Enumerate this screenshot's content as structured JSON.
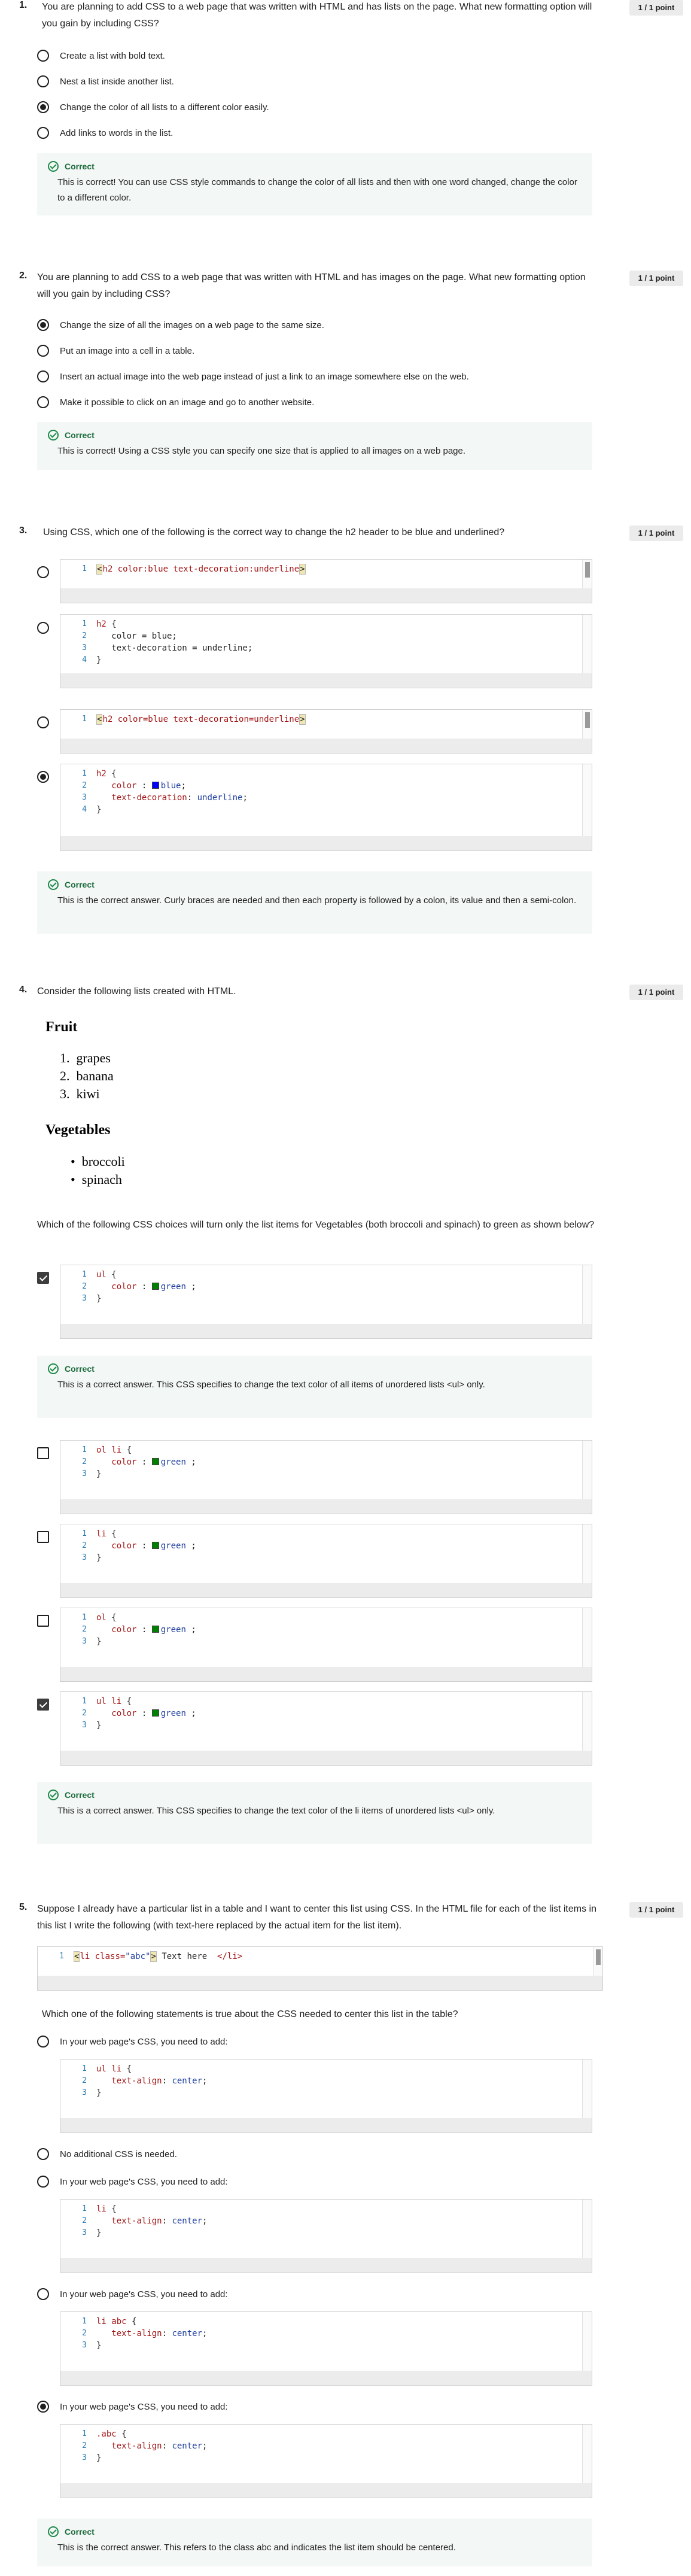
{
  "points_label": "1 / 1 point",
  "correct_label": "Correct",
  "q1": {
    "num": "1.",
    "text": "You are planning to add CSS to a web page that was written with HTML and has lists on the page. What new formatting option will you gain by including CSS?",
    "options": [
      "Create a list with bold text.",
      "Nest a list inside another list.",
      "Change the color of all lists to a different color easily.",
      "Add links to words in the list."
    ],
    "feedback": "This is correct! You can use CSS style commands to change the color of all lists and then with one word changed, change the color to a different color."
  },
  "q2": {
    "num": "2.",
    "text": "You are planning to add CSS to a web page that was written with HTML and has images on the page. What new formatting option will you gain by including CSS?",
    "options": [
      "Change the size of all the images on a web page to the same size.",
      "Put an image into a cell in a table.",
      "Insert an actual image into the web page instead of just a link to an image somewhere else on the web.",
      "Make it possible to click on an image and go to another website."
    ],
    "feedback": "This is correct! Using a CSS style you can specify one size that is applied to all images on a web page."
  },
  "q3": {
    "num": "3.",
    "text": "Using CSS, which one of the following is the correct way to change the h2 header to be blue and underlined?",
    "feedback": "This is the correct answer. Curly braces are needed and then each property is followed by a colon, its value and then a semi-colon."
  },
  "q4": {
    "num": "4.",
    "text": "Consider the following lists created with HTML.",
    "fruit_title": "Fruit",
    "fruits": [
      "grapes",
      "banana",
      "kiwi"
    ],
    "veg_title": "Vegetables",
    "vegs": [
      "broccoli",
      "spinach"
    ],
    "question": "Which of the following CSS choices will turn only the list items for Vegetables (both broccoli and spinach) to green as shown below?",
    "feedback1": "This is a correct answer. This CSS specifies to change the text color of all items of unordered lists <ul> only.",
    "feedback2": "This is a correct answer. This CSS specifies to change the text color of the li items of unordered lists <ul> only."
  },
  "q5": {
    "num": "5.",
    "text": "Suppose I already have a particular list in a table and I want to center this list using CSS. In the HTML file for each of the list items in this list I write the following (with text-here replaced by the actual item for the list item).",
    "question": "Which one of the following statements is true about the CSS needed to center this list in the table?",
    "opt_add": "In your web page's CSS, you need to add:",
    "opt_none": "No additional CSS is needed.",
    "feedback": "This is the correct answer. This refers to the class abc and indicates the list item should be centered."
  },
  "colors": {
    "correct": "#1d8a4a",
    "feedback_bg": "#f3f7f5",
    "badge_bg": "#ebebeb"
  }
}
